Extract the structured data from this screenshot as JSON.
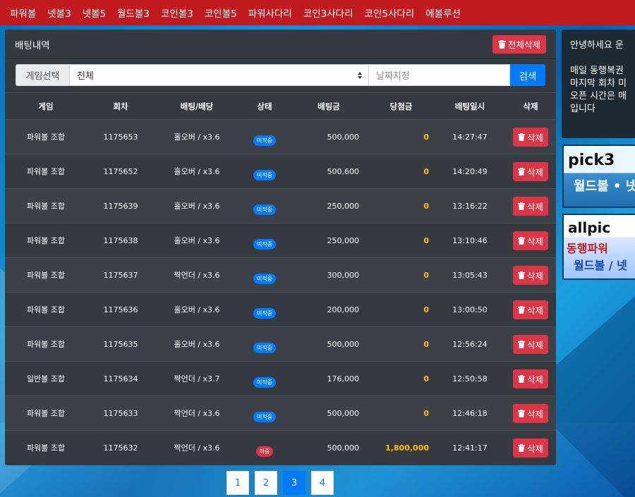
{
  "nav": [
    "파워볼",
    "넷볼3",
    "넷볼5",
    "월드볼3",
    "코인볼3",
    "코인볼5",
    "파워사다리",
    "코인3사다리",
    "코인5사다리",
    "에볼루션"
  ],
  "panel": {
    "title": "배팅내역",
    "delete_all_label": "전체삭제"
  },
  "filter": {
    "game_label": "게임선택",
    "game_selected": "전체",
    "date_placeholder": "날짜지정",
    "search_label": "검색"
  },
  "table": {
    "headers": [
      "게임",
      "회차",
      "배팅/배당",
      "상태",
      "배팅금",
      "당첨금",
      "배팅일시",
      "삭제"
    ],
    "delete_label": "삭제",
    "rows": [
      {
        "game": "파워볼 조합",
        "round": "1175653",
        "bet": "홀오버 / x3.6",
        "status": "미적중",
        "amount": "500,000",
        "win": "0",
        "time": "14:27:47"
      },
      {
        "game": "파워볼 조합",
        "round": "1175652",
        "bet": "홀오버 / x3.6",
        "status": "미적중",
        "amount": "500,600",
        "win": "0",
        "time": "14:20:49"
      },
      {
        "game": "파워볼 조합",
        "round": "1175639",
        "bet": "홀오버 / x3.6",
        "status": "미적중",
        "amount": "250,000",
        "win": "0",
        "time": "13:16:22"
      },
      {
        "game": "파워볼 조합",
        "round": "1175638",
        "bet": "홀오버 / x3.6",
        "status": "미적중",
        "amount": "250,000",
        "win": "0",
        "time": "13:10:46"
      },
      {
        "game": "파워볼 조합",
        "round": "1175637",
        "bet": "짝언더 / x3.6",
        "status": "미적중",
        "amount": "300,000",
        "win": "0",
        "time": "13:05:43"
      },
      {
        "game": "파워볼 조합",
        "round": "1175636",
        "bet": "홀오버 / x3.6",
        "status": "미적중",
        "amount": "200,000",
        "win": "0",
        "time": "13:00:50"
      },
      {
        "game": "파워볼 조합",
        "round": "1175635",
        "bet": "홀오버 / x3.6",
        "status": "미적중",
        "amount": "500,000",
        "win": "0",
        "time": "12:56:24"
      },
      {
        "game": "일반볼 조합",
        "round": "1175634",
        "bet": "짝언더 / x3.7",
        "status": "미적중",
        "amount": "176,000",
        "win": "0",
        "time": "12:50:58"
      },
      {
        "game": "파워볼 조합",
        "round": "1175633",
        "bet": "짝언더 / x3.6",
        "status": "미적중",
        "amount": "500,000",
        "win": "0",
        "time": "12:46:18"
      },
      {
        "game": "파워볼 조합",
        "round": "1175632",
        "bet": "짝언더 / x3.6",
        "status": "적중",
        "amount": "500,000",
        "win": "1,800,000",
        "time": "12:41:17"
      }
    ]
  },
  "pagination": {
    "pages": [
      "1",
      "2",
      "3",
      "4"
    ],
    "active": "3"
  },
  "sidebar": {
    "notice_lines": [
      "안녕하세요 운",
      "",
      "매일 동행복권",
      "마지막 회차 미",
      "오픈 시간은 매",
      "입니다"
    ],
    "banner1": {
      "logo": "pick3",
      "text": "월드볼 • 넷"
    },
    "banner2": {
      "logo": "allpic",
      "line1": "동행파워",
      "line2": "월드볼 / 넷"
    }
  },
  "colors": {
    "nav_bg": "#c0191e",
    "panel_bg": "#343a40",
    "primary": "#007bff",
    "danger": "#dc3545",
    "win": "#ffc107"
  }
}
